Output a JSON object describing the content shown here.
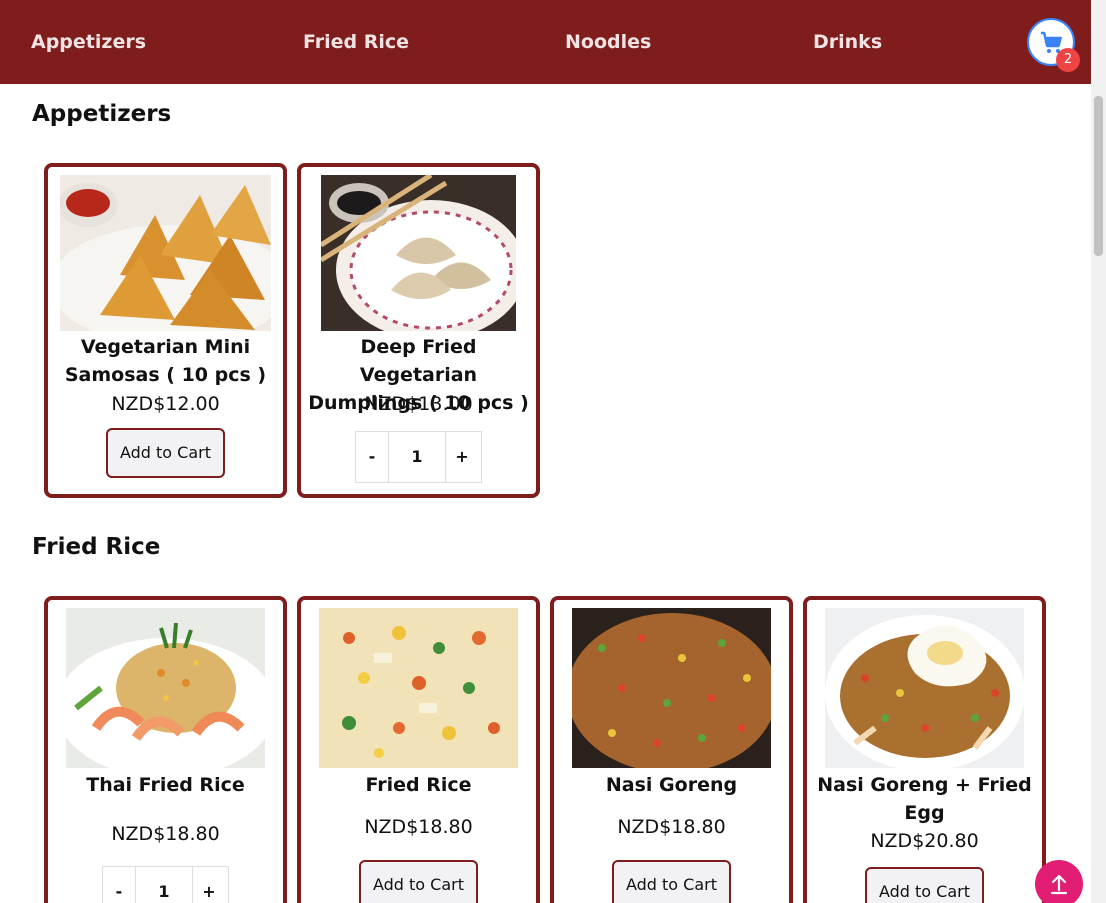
{
  "nav": {
    "items": [
      {
        "label": "Appetizers"
      },
      {
        "label": "Fried Rice"
      },
      {
        "label": "Noodles"
      },
      {
        "label": "Drinks"
      }
    ],
    "cart_icon": "shopping-cart-icon",
    "cart_count": "2"
  },
  "sections": [
    {
      "title": "Appetizers",
      "items": [
        {
          "name": "Vegetarian Mini Samosas ( 10 pcs )",
          "price": "NZD$12.00",
          "action": "Add to Cart"
        },
        {
          "name": "Deep Fried Vegetarian Dumplings ( 10 pcs )",
          "price": "NZD$13.00",
          "qty_minus": "-",
          "qty_value": "1",
          "qty_plus": "+"
        }
      ]
    },
    {
      "title": "Fried Rice",
      "items": [
        {
          "name": "Thai Fried Rice",
          "price": "NZD$18.80",
          "qty_minus": "-",
          "qty_value": "1",
          "qty_plus": "+"
        },
        {
          "name": "Fried Rice",
          "price": "NZD$18.80",
          "action": "Add to Cart"
        },
        {
          "name": "Nasi Goreng",
          "price": "NZD$18.80",
          "action": "Add to Cart"
        },
        {
          "name": "Nasi Goreng + Fried Egg",
          "price": "NZD$20.80",
          "action": "Add to Cart"
        }
      ]
    }
  ],
  "scroll_top_icon": "arrow-up-icon",
  "colors": {
    "nav_bg": "#7f1c1c",
    "card_border": "#7f1c1c",
    "cart_badge": "#ef4444",
    "fab": "#e11d74",
    "cart_icon": "#3b82f6"
  }
}
